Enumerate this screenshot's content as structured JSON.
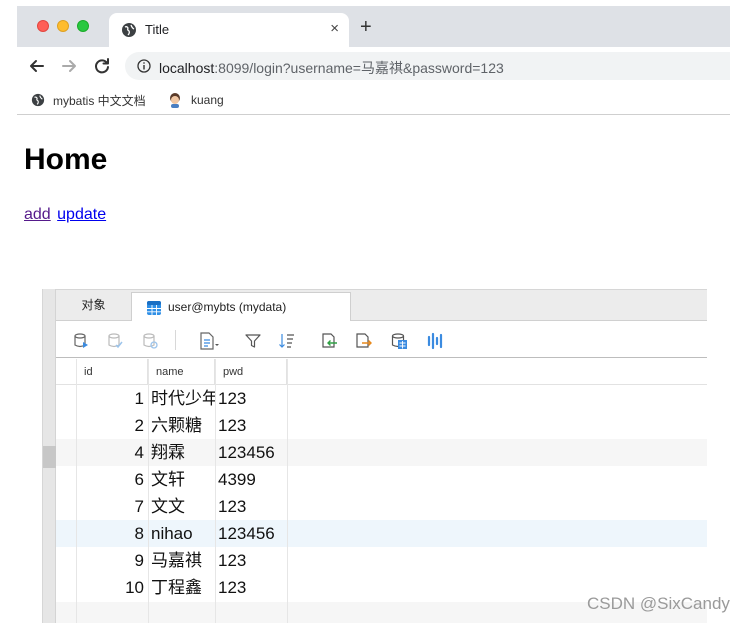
{
  "browser": {
    "tab_title": "Title",
    "new_tab_label": "+",
    "close_tab_label": "×",
    "url_host": "localhost",
    "url_rest": ":8099/login?username=马嘉祺&password=123",
    "bookmarks": [
      {
        "label": "mybatis 中文文档",
        "icon": "globe-icon"
      },
      {
        "label": "kuang",
        "icon": "avatar-icon"
      }
    ]
  },
  "page": {
    "title": "Home",
    "links": {
      "add": "add",
      "update": "update"
    }
  },
  "db_tool": {
    "tabs": {
      "objects": "对象",
      "table": "user@mybts (mydata)"
    },
    "columns": [
      "id",
      "name",
      "pwd"
    ],
    "rows": [
      {
        "id": "1",
        "name": "时代少年",
        "pwd": "123"
      },
      {
        "id": "2",
        "name": "六颗糖",
        "pwd": "123"
      },
      {
        "id": "4",
        "name": "翔霖",
        "pwd": "123456"
      },
      {
        "id": "6",
        "name": "文轩",
        "pwd": "4399"
      },
      {
        "id": "7",
        "name": "文文",
        "pwd": "123"
      },
      {
        "id": "8",
        "name": "nihao",
        "pwd": "123456"
      },
      {
        "id": "9",
        "name": "马嘉祺",
        "pwd": "123"
      },
      {
        "id": "10",
        "name": "丁程鑫",
        "pwd": "123"
      }
    ]
  },
  "watermark": "CSDN @SixCandy",
  "colors": {
    "link_visited": "#551a8b",
    "link": "#0000ee",
    "accent_blue": "#1a73e8"
  }
}
